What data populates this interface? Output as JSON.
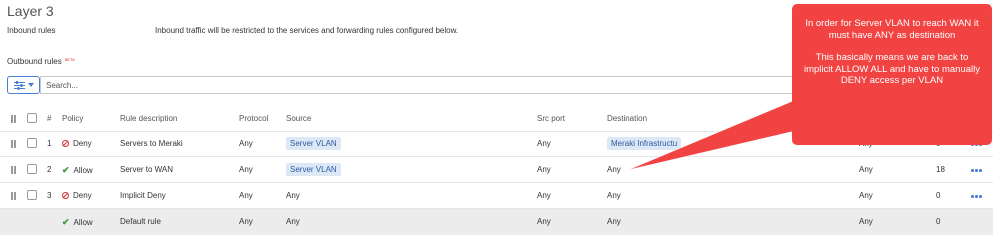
{
  "section_title": "Layer 3",
  "inbound": {
    "label": "Inbound rules",
    "description": "Inbound traffic will be restricted to the services and forwarding rules configured below."
  },
  "outbound": {
    "label": "Outbound rules",
    "beta": "BETA"
  },
  "toolbar": {
    "filter_icon": "sliders-icon",
    "search_placeholder": "Search..."
  },
  "table": {
    "headers": {
      "num": "#",
      "policy": "Policy",
      "description": "Rule description",
      "protocol": "Protocol",
      "source": "Source",
      "src_port": "Src port",
      "destination": "Destination"
    },
    "rows": [
      {
        "num": "1",
        "policy": "Deny",
        "description": "Servers to Meraki",
        "protocol": "Any",
        "source": "Server VLAN",
        "src_port": "Any",
        "destination": "Meraki Infrastructu",
        "dst_port": "Any",
        "hits": "0"
      },
      {
        "num": "2",
        "policy": "Allow",
        "description": "Server to WAN",
        "protocol": "Any",
        "source": "Server VLAN",
        "src_port": "Any",
        "destination": "Any",
        "dst_port": "Any",
        "hits": "18"
      },
      {
        "num": "3",
        "policy": "Deny",
        "description": "Implicit Deny",
        "protocol": "Any",
        "source": "Any",
        "src_port": "Any",
        "destination": "Any",
        "dst_port": "Any",
        "hits": "0"
      }
    ],
    "default_row": {
      "policy": "Allow",
      "description": "Default rule",
      "protocol": "Any",
      "source": "Any",
      "src_port": "Any",
      "destination": "Any",
      "dst_port": "Any",
      "hits": "0"
    }
  },
  "callout": {
    "line1": "In order for Server VLAN to reach WAN it must have ANY as destination",
    "line2": "This basically means we are back to implicit ALLOW ALL and have to manually DENY access per VLAN"
  },
  "colors": {
    "callout": "#f24343",
    "deny": "#d0312d",
    "allow": "#3a9a3a",
    "tag_bg": "#dde8f7",
    "accent": "#4a7fd0"
  }
}
